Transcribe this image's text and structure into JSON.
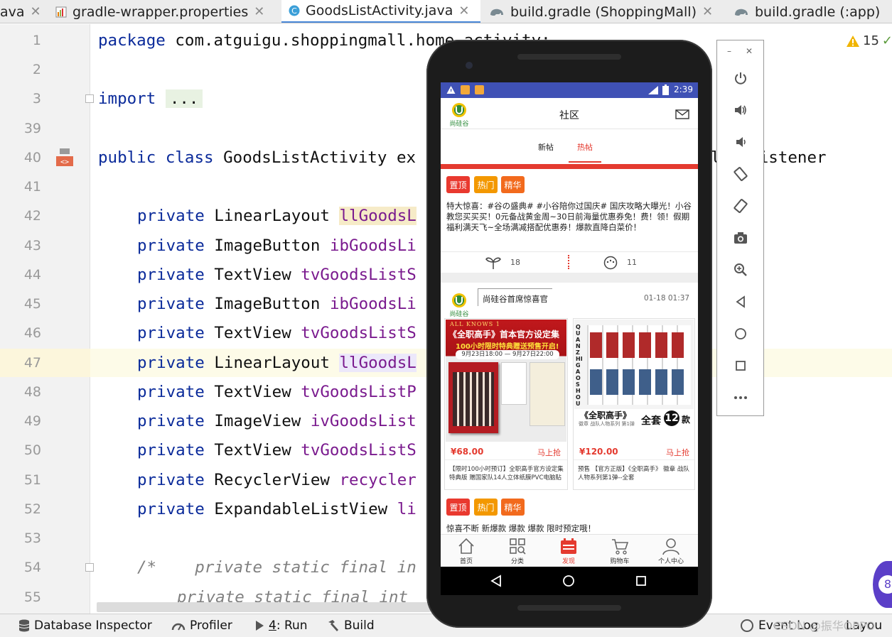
{
  "tabs": [
    {
      "label": "ava",
      "active": false
    },
    {
      "label": "gradle-wrapper.properties",
      "active": false
    },
    {
      "label": "GoodsListActivity.java",
      "active": true
    },
    {
      "label": "build.gradle (ShoppingMall)",
      "active": false
    },
    {
      "label": "build.gradle (:app)",
      "active": false
    }
  ],
  "editor": {
    "warnings_count": "15",
    "lines": [
      {
        "num": "1"
      },
      {
        "num": "2"
      },
      {
        "num": "3"
      },
      {
        "num": "39"
      },
      {
        "num": "40"
      },
      {
        "num": "41"
      },
      {
        "num": "42"
      },
      {
        "num": "43"
      },
      {
        "num": "44"
      },
      {
        "num": "45"
      },
      {
        "num": "46"
      },
      {
        "num": "47"
      },
      {
        "num": "48"
      },
      {
        "num": "49"
      },
      {
        "num": "50"
      },
      {
        "num": "51"
      },
      {
        "num": "52"
      },
      {
        "num": "53"
      },
      {
        "num": "54"
      },
      {
        "num": "55"
      }
    ],
    "code": {
      "l1_kw": "package",
      "l1_rest": " com.atguigu.shoppingmall.home.activity;",
      "l3_kw": "import",
      "l3_rest": "...",
      "l40_kw": "public class",
      "l40_rest": " GoodsListActivity ex",
      "l40_tail": "lickListener",
      "private": "private",
      "l42_type": "LinearLayout",
      "l42_field": "llGoodsL",
      "l43_type": "ImageButton",
      "l43_field": "ibGoodsLi",
      "l44_type": "TextView",
      "l44_field": "tvGoodsListS",
      "l45_type": "ImageButton",
      "l45_field": "ibGoodsLi",
      "l46_type": "TextView",
      "l46_field": "tvGoodsListS",
      "l47_type": "LinearLayout",
      "l47_field": "llGoodsL",
      "l48_type": "TextView",
      "l48_field": "tvGoodsListP",
      "l49_type": "ImageView",
      "l49_field": "ivGoodsList",
      "l50_type": "TextView",
      "l50_field": "tvGoodsListS",
      "l51_type": "RecyclerView",
      "l51_field": "recycler",
      "l52_type": "ExpandableListView",
      "l52_field": "li",
      "l54": "/*    private static final in",
      "l55": "private static final int"
    }
  },
  "statusbar_tools": {
    "database_inspector": "Database Inspector",
    "profiler": "Profiler",
    "run_num": "4",
    "run": ": Run",
    "build": "Build",
    "event_log": "Event Log",
    "layout": "Layou",
    "watermark": "CSDN @振华OPPO"
  },
  "phone": {
    "time": "2:39",
    "logo_text": "尚硅谷",
    "title": "社区",
    "subtabs": [
      "新帖",
      "热帖"
    ],
    "active_subtab": "热帖",
    "chips": [
      "置顶",
      "热门",
      "精华"
    ],
    "post1_text": "特大惊喜：#谷の盛典# #小谷陪你过国庆# 国庆攻略大曝光！小谷教您买买买！0元备战黄金周~30日前海量优惠券免！费！领！假期福利满天飞~全场满减搭配优惠券！爆款直降白菜价！",
    "likes": "18",
    "comments": "11",
    "post2_user": "尚硅谷首席惊喜官",
    "post2_time": "01-18 01:37",
    "product1": {
      "banner1": "ALL KNOWS 1",
      "banner2": "《全职高手》首本官方设定集",
      "banner3": "100小时限时特典赠送预售开启!",
      "banner4": "9月23日18:00 — 9月27日22:00",
      "price": "¥68.00",
      "buy": "马上抢",
      "desc": "【限时100小时预订】全职高手官方设定集 特典版 赠国家队14人立体纸膜PVC电脑贴"
    },
    "product2": {
      "side_text": "QUANZHIGAOSHOU",
      "banner1": "《全职高手》",
      "banner2": "徽章 战队人物系列 第1弹",
      "banner3": "全套",
      "banner4": "12",
      "banner5": "款",
      "price": "¥120.00",
      "buy": "马上抢",
      "desc": "预售 【官方正版】《全职高手》 徽章 战队人物系列第1弹--全套"
    },
    "post3_text": "惊喜不断 新爆款 爆款 爆款 限时预定哦！",
    "bottom_nav": [
      "首页",
      "分类",
      "发现",
      "购物车",
      "个人中心"
    ],
    "active_nav": "发现"
  },
  "colors": {
    "accent_blue": "#3f51b5",
    "accent_red": "#e43a2f",
    "keyword": "#0a2a9a",
    "field": "#7a1a8e"
  }
}
